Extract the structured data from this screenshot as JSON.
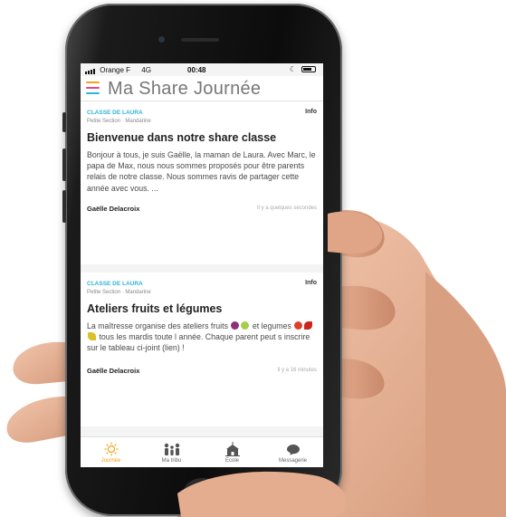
{
  "status_bar": {
    "carrier": "Orange F",
    "network": "4G",
    "time": "00:48"
  },
  "header": {
    "title": "Ma Share Journée",
    "menu_icon": "hamburger-icon",
    "menu_colors": [
      "#f3a21b",
      "#e0468a",
      "#2fb5d8"
    ]
  },
  "feed": {
    "posts": [
      {
        "class_name": "CLASSE DE LAURA",
        "section": "Petite Section · Mandarine",
        "tag": "Info",
        "title": "Bienvenue dans notre share classe",
        "body": "Bonjour à tous, je suis Gaëlle, la maman de Laura. Avec Marc, le papa de Max, nous nous sommes proposés pour être parents relais de notre classe. Nous sommes ravis de partager cette année avec vous. ...",
        "author": "Gaëlle Delacroix",
        "time": "Il y a quelques secondes"
      },
      {
        "class_name": "CLASSE DE LAURA",
        "section": "Petite Section · Mandarine",
        "tag": "Info",
        "title": "Ateliers fruits et légumes",
        "body_part1": "La maîtresse organise des ateliers fruits",
        "body_part2": "et legumes",
        "body_part3": "tous les mardis toute l année. Chaque parent peut s inscrire sur le tableau ci-joint (lien) !",
        "author": "Gaëlle Delacroix",
        "time": "Il y a 16 minutes"
      }
    ]
  },
  "tab_bar": {
    "tabs": [
      {
        "label": "Journée",
        "icon": "sun-icon",
        "active": true
      },
      {
        "label": "Ma tribu",
        "icon": "family-icon",
        "active": false
      },
      {
        "label": "Ecole",
        "icon": "school-icon",
        "active": false
      },
      {
        "label": "Messagerie",
        "icon": "chat-bubble-icon",
        "active": false
      }
    ]
  },
  "colors": {
    "accent_blue": "#2fb5d8",
    "accent_orange": "#f3a21b"
  }
}
